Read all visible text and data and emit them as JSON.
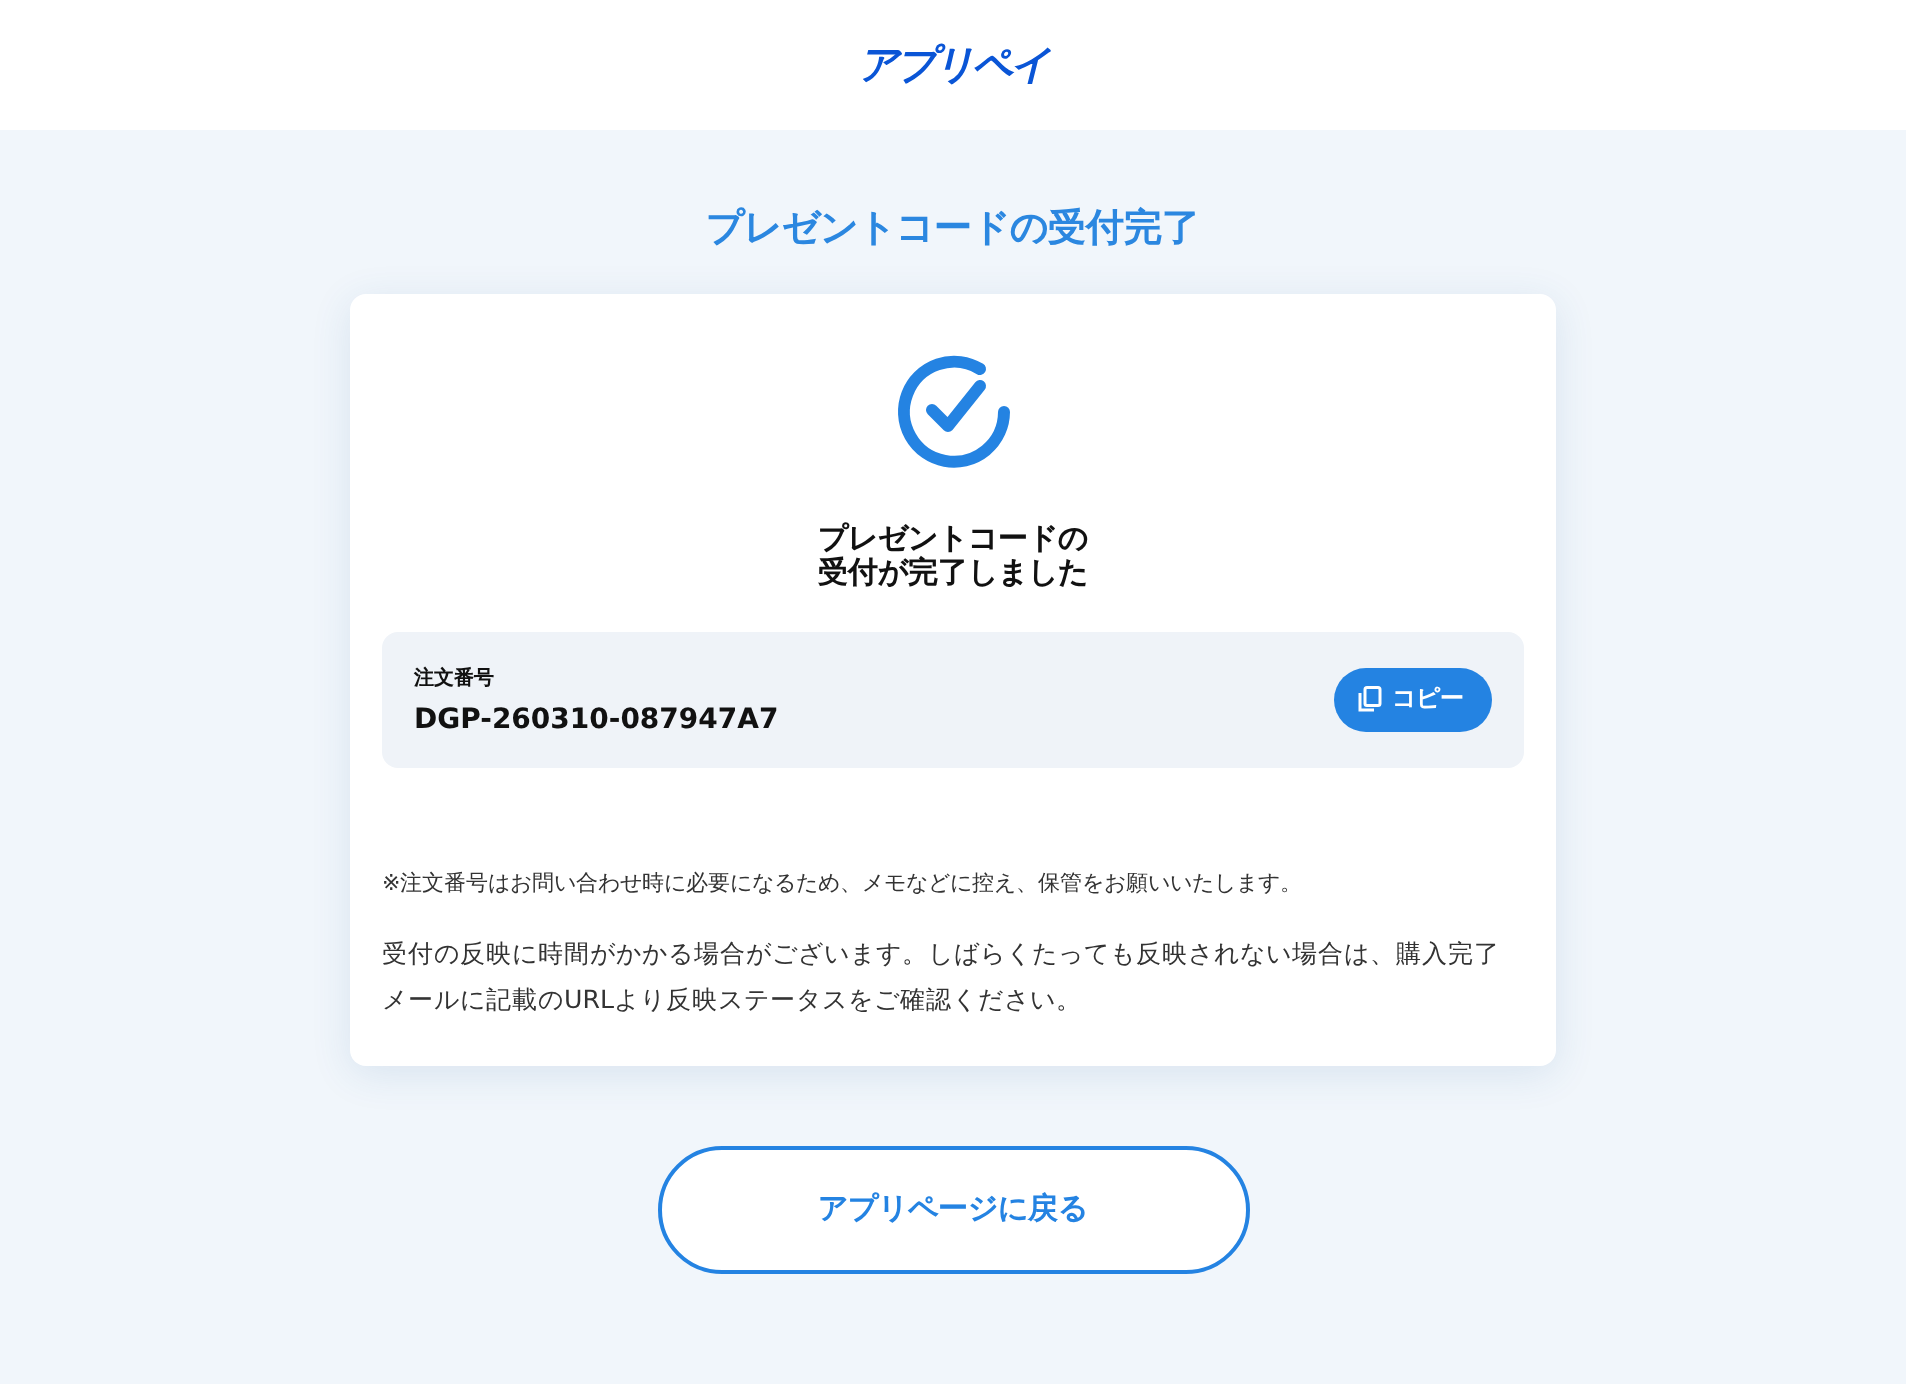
{
  "header": {
    "logo": "アプリペイ"
  },
  "page_title": "プレゼントコードの受付完了",
  "card": {
    "heading_lines": [
      "プレゼントコードの",
      "受付が完了しました"
    ],
    "order": {
      "label": "注文番号",
      "value": "DGP-260310-087947A7",
      "copy_button": "コピー"
    },
    "note": "※注文番号はお問い合わせ時に必要になるため、メモなどに控え、保管をお願いいたします。",
    "message": "受付の反映に時間がかかる場合がございます。しばらくたっても反映されない場合は、購入完了メールに記載のURLより反映ステータスをご確認ください。"
  },
  "back_button": "アプリページに戻る"
}
